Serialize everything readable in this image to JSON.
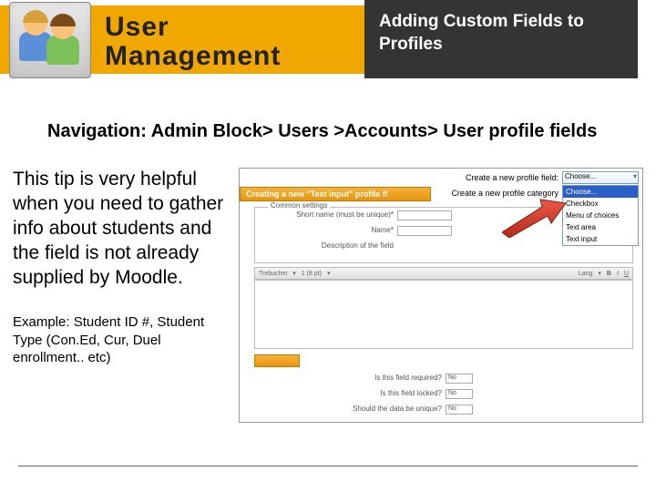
{
  "header": {
    "title_line1": "User",
    "title_line2": "Management",
    "subtitle": "Adding Custom Fields to Profiles"
  },
  "navigation": {
    "prefix": "Navigation: ",
    "path": "Admin Block> Users >Accounts> User profile fields"
  },
  "body": {
    "tip": "This tip is very helpful when you need to gather info about students and the field is not already supplied by Moodle.",
    "example": "Example: Student ID #, Student Type (Con.Ed, Cur, Duel enrollment.. etc)"
  },
  "mockup": {
    "create_field_label": "Create a new profile field:",
    "create_field_value": "Choose...",
    "create_category_label": "Create a new profile category",
    "dropdown": [
      "Choose...",
      "Checkbox",
      "Menu of choices",
      "Text area",
      "Text input"
    ],
    "orange_header": "Creating a new \"Text input\" profile fi",
    "legend": "Common settings",
    "short_name_label": "Short name (must be unique)",
    "name_label": "Name",
    "desc_label": "Description of the field",
    "font_family": "Trebuchet",
    "font_size": "1 (8 pt)",
    "lang": "Lang",
    "req_label": "Is this field required?",
    "locked_label": "Is this field locked?",
    "unique_label": "Should the data be unique?",
    "select_no": "No"
  }
}
